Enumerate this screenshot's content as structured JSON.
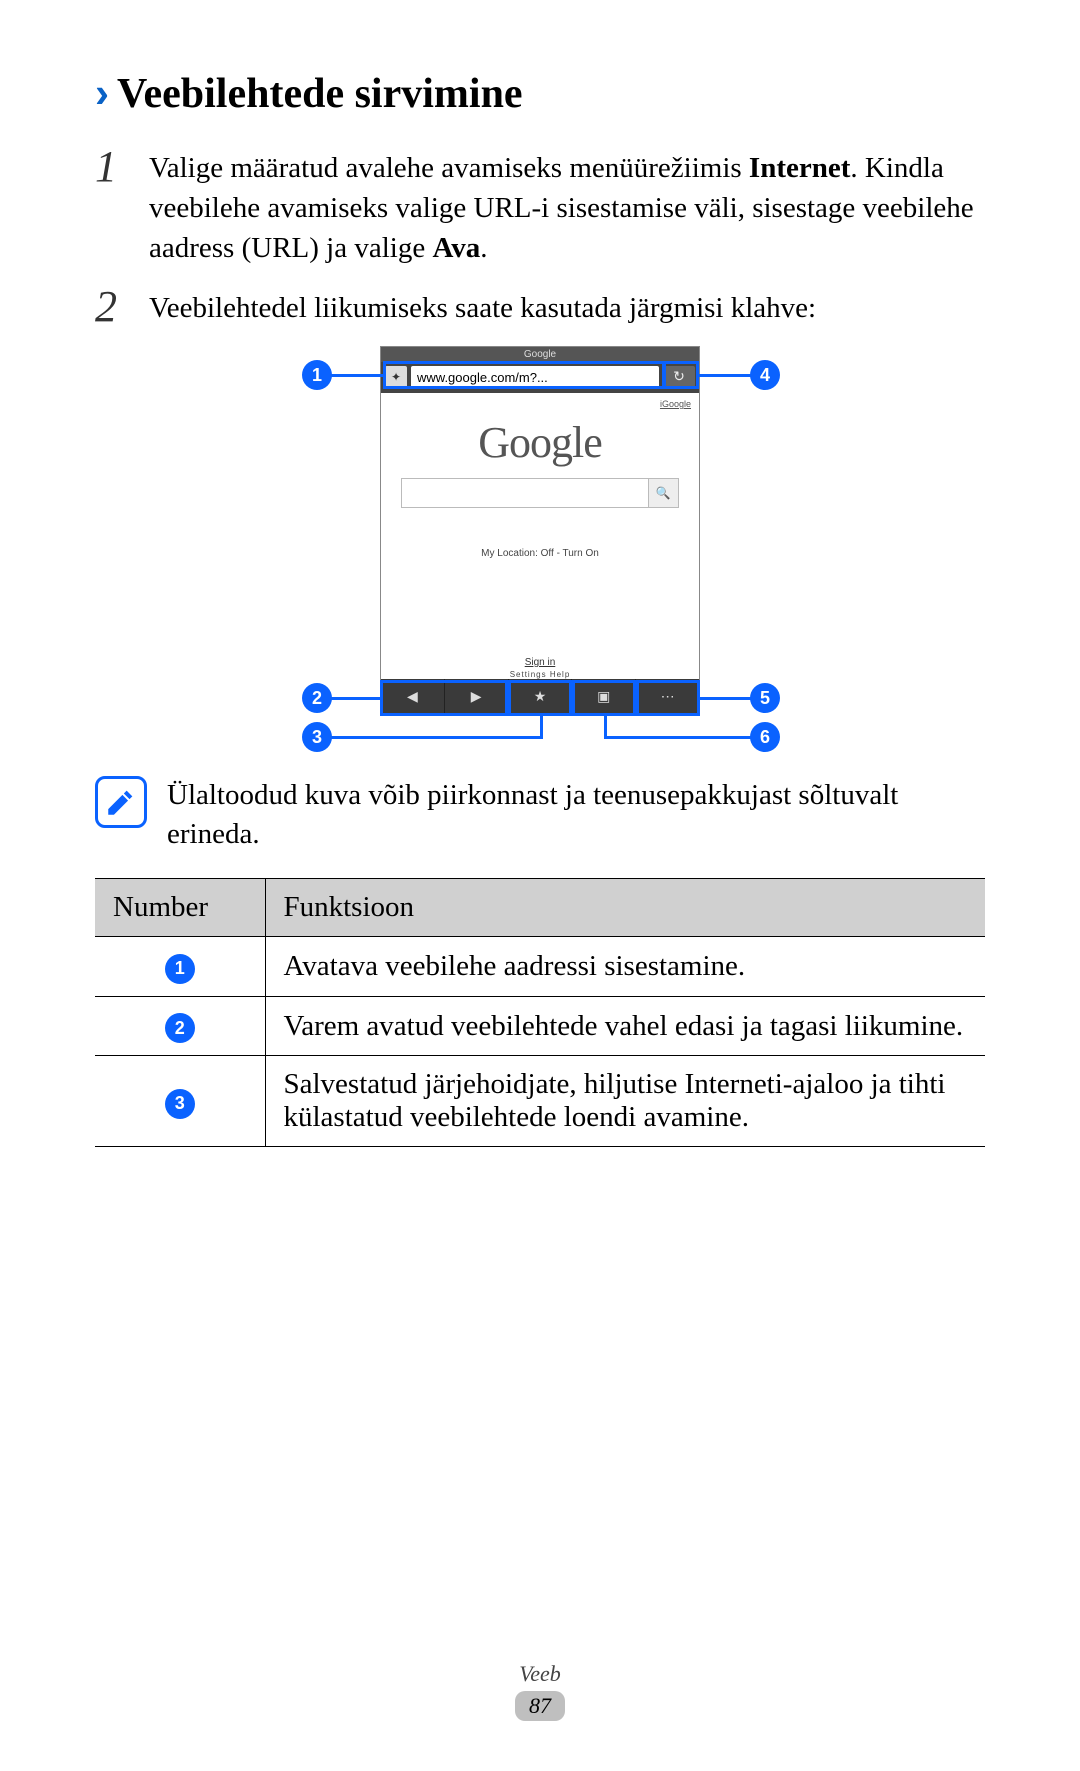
{
  "heading": {
    "title": "Veebilehtede sirvimine"
  },
  "steps": {
    "s1": {
      "num": "1",
      "text_a": "Valige määratud avalehe avamiseks menüürežiimis ",
      "bold_a": "Internet",
      "text_suffix_a": ".",
      "text_b": "Kindla veebilehe avamiseks valige URL-i sisestamise väli, sisestage veebilehe aadress (URL) ja valige ",
      "bold_b": "Ava",
      "text_suffix_b": "."
    },
    "s2": {
      "num": "2",
      "text": "Veebilehtedel liikumiseks saate kasutada järgmisi klahve:"
    }
  },
  "phone": {
    "header": "Google",
    "url": "www.google.com/m?...",
    "igoogle": "iGoogle",
    "logo": "Google",
    "my_location": "My Location: Off - Turn On",
    "sign_in": "Sign in",
    "settings_line": "Settings   Help"
  },
  "callouts": {
    "c1": "1",
    "c2": "2",
    "c3": "3",
    "c4": "4",
    "c5": "5",
    "c6": "6"
  },
  "note": {
    "text": "Ülaltoodud kuva võib piirkonnast ja teenusepakkujast sõltuvalt erineda."
  },
  "table": {
    "h1": "Number",
    "h2": "Funktsioon",
    "rows": [
      {
        "n": "1",
        "f": "Avatava veebilehe aadressi sisestamine."
      },
      {
        "n": "2",
        "f": "Varem avatud veebilehtede vahel edasi ja tagasi liikumine."
      },
      {
        "n": "3",
        "f": "Salvestatud järjehoidjate, hiljutise Interneti-ajaloo ja tihti külastatud veebilehtede loendi avamine."
      }
    ]
  },
  "footer": {
    "section": "Veeb",
    "page": "87"
  }
}
